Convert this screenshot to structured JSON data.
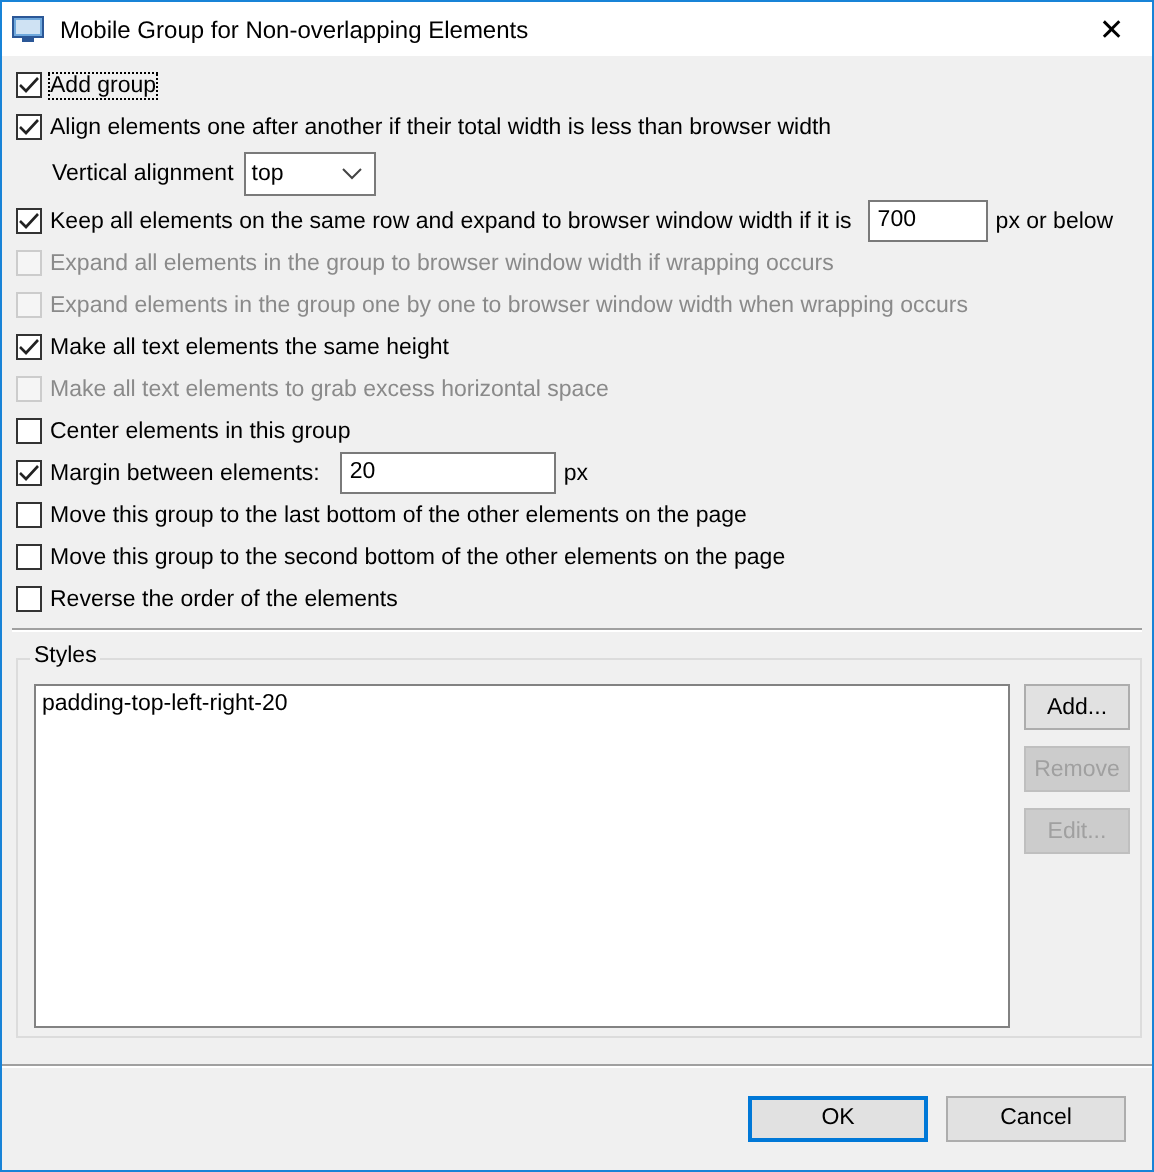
{
  "window": {
    "title": "Mobile Group for Non-overlapping Elements",
    "close": "✕"
  },
  "options": [
    {
      "kind": "checkbox",
      "label": "Add group",
      "checked": true,
      "disabled": false,
      "focused": true
    },
    {
      "kind": "checkbox",
      "label": "Align elements one after another if their total width is less than browser width",
      "checked": true,
      "disabled": false,
      "focused": false
    },
    {
      "kind": "select",
      "label": "Vertical alignment",
      "value": "top"
    },
    {
      "kind": "checkbox-field",
      "label": "Keep all elements on the same row and expand to browser window width if it is",
      "checked": true,
      "disabled": false,
      "focused": false,
      "value": "700",
      "suffix": "px or below"
    },
    {
      "kind": "checkbox",
      "label": "Expand all elements in the group to browser window width if wrapping occurs",
      "checked": false,
      "disabled": true,
      "focused": false
    },
    {
      "kind": "checkbox",
      "label": "Expand elements in the group one by one to browser window width when wrapping occurs",
      "checked": false,
      "disabled": true,
      "focused": false
    },
    {
      "kind": "checkbox",
      "label": "Make all text elements the same height",
      "checked": true,
      "disabled": false,
      "focused": false
    },
    {
      "kind": "checkbox",
      "label": "Make all text elements to grab excess horizontal space",
      "checked": false,
      "disabled": true,
      "focused": false
    },
    {
      "kind": "checkbox",
      "label": "Center elements in this group",
      "checked": false,
      "disabled": false,
      "focused": false
    },
    {
      "kind": "checkbox-field",
      "label": "Margin between elements:",
      "checked": true,
      "disabled": false,
      "focused": false,
      "value": "20",
      "suffix": "px"
    },
    {
      "kind": "checkbox",
      "label": "Move this group to the last bottom of the other elements on the page",
      "checked": false,
      "disabled": false,
      "focused": false
    },
    {
      "kind": "checkbox",
      "label": "Move this group to the second bottom of the other elements on the page",
      "checked": false,
      "disabled": false,
      "focused": false
    },
    {
      "kind": "checkbox",
      "label": "Reverse the order of the elements",
      "checked": false,
      "disabled": false,
      "focused": false
    }
  ],
  "styles": {
    "title": "Styles",
    "items": [
      {
        "label": "padding-top-left-right-20",
        "selected": false
      }
    ],
    "buttons": [
      {
        "label": "Add...",
        "disabled": false
      },
      {
        "label": "Remove",
        "disabled": true
      },
      {
        "label": "Edit...",
        "disabled": true
      }
    ]
  },
  "footer_buttons": [
    {
      "label": "OK",
      "default": true
    },
    {
      "label": "Cancel",
      "default": false
    }
  ]
}
